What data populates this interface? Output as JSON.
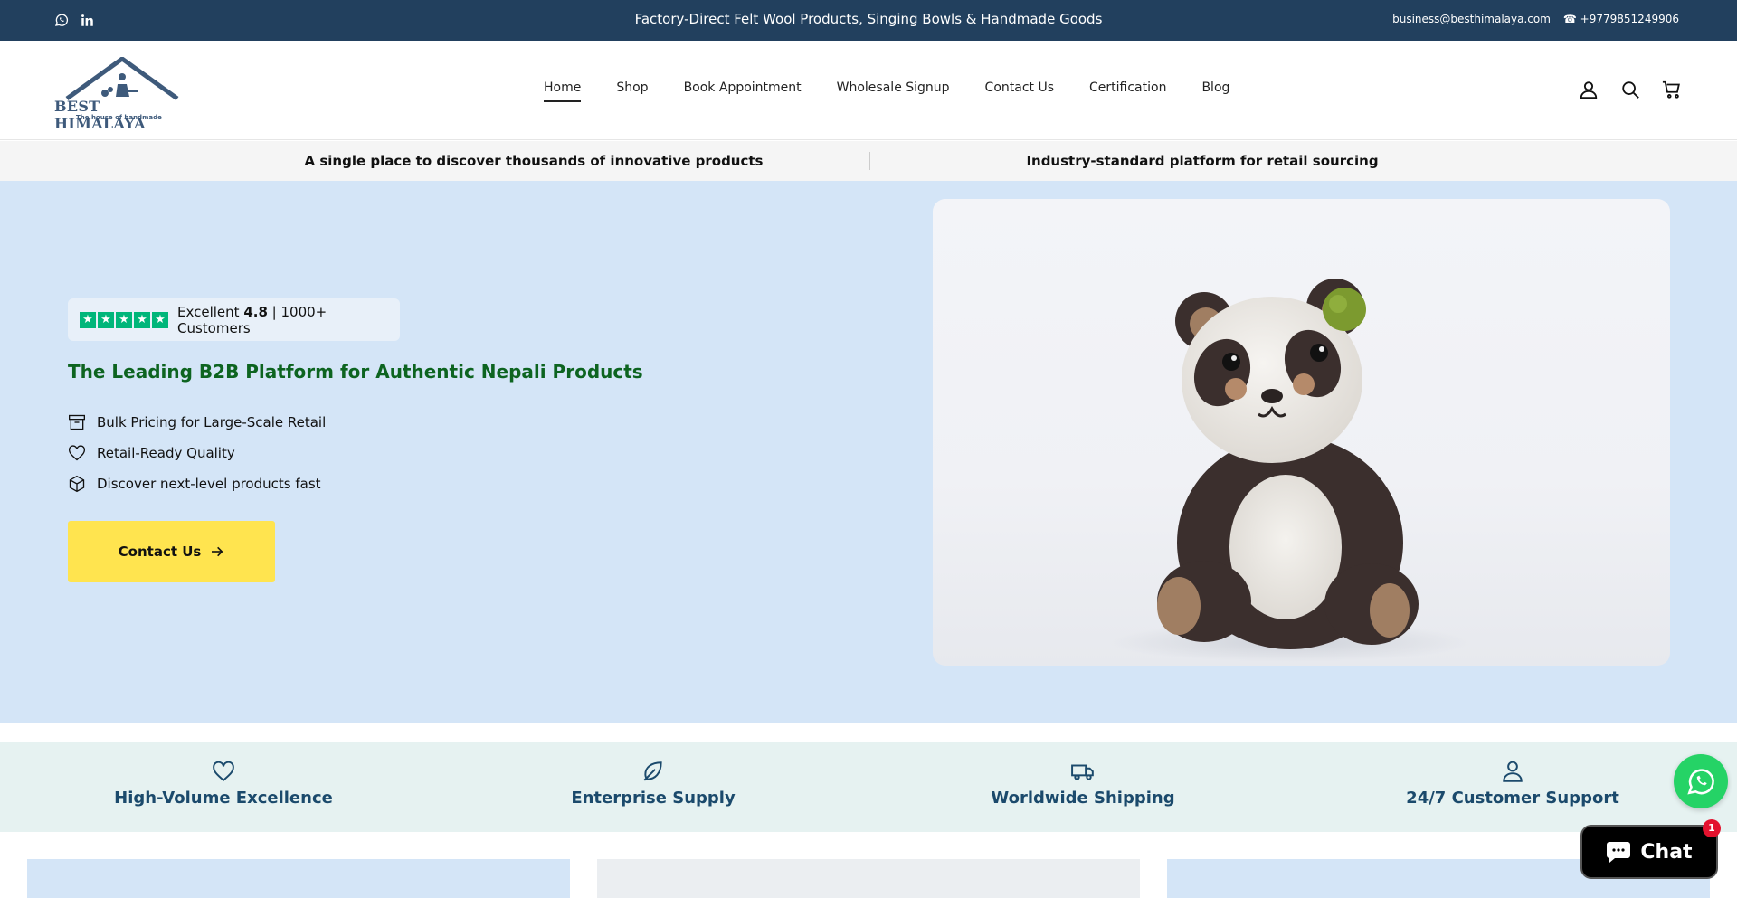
{
  "topbar": {
    "social_icons": [
      "whatsapp-icon",
      "linkedin-icon"
    ],
    "announcement": "Factory-Direct Felt Wool Products, Singing Bowls & Handmade Goods",
    "email": "business@besthimalaya.com",
    "phone": "☎ +9779851249906"
  },
  "header": {
    "logo_text": "BEST HIMALAYA",
    "logo_tagline": "The house of handmade",
    "nav": [
      {
        "label": "Home",
        "active": true
      },
      {
        "label": "Shop"
      },
      {
        "label": "Book Appointment"
      },
      {
        "label": "Wholesale Signup"
      },
      {
        "label": "Contact Us"
      },
      {
        "label": "Certification"
      },
      {
        "label": "Blog"
      }
    ],
    "icons": [
      "account-icon",
      "search-icon",
      "cart-icon"
    ]
  },
  "strip": {
    "left": "A single place to discover thousands of innovative products",
    "right": "Industry-standard platform for retail sourcing"
  },
  "hero": {
    "rating_prefix": "Excellent",
    "rating_value": "4.8",
    "rating_suffix": "| 1000+ Customers",
    "star_count": 5,
    "title": "The Leading B2B Platform for Authentic Nepali Products",
    "features": [
      {
        "icon": "box-icon",
        "label": "Bulk Pricing for Large-Scale Retail"
      },
      {
        "icon": "heart-icon",
        "label": "Retail-Ready Quality"
      },
      {
        "icon": "package-icon",
        "label": "Discover next-level products fast"
      }
    ],
    "cta_label": "Contact Us"
  },
  "trust": [
    {
      "icon": "heart-icon",
      "label": "High-Volume Excellence"
    },
    {
      "icon": "leaf-icon",
      "label": "Enterprise Supply"
    },
    {
      "icon": "truck-icon",
      "label": "Worldwide Shipping"
    },
    {
      "icon": "user-icon",
      "label": "24/7 Customer Support"
    }
  ],
  "chat": {
    "label": "Chat",
    "badge": "1"
  },
  "colors": {
    "topbar": "#22405e",
    "hero_bg": "#d4e5f7",
    "title_green": "#0d6420",
    "cta_yellow": "#ffe44f",
    "trust_bg": "#e6f2f1",
    "trust_text": "#1b4a6c",
    "trustpilot_green": "#00b67a"
  }
}
